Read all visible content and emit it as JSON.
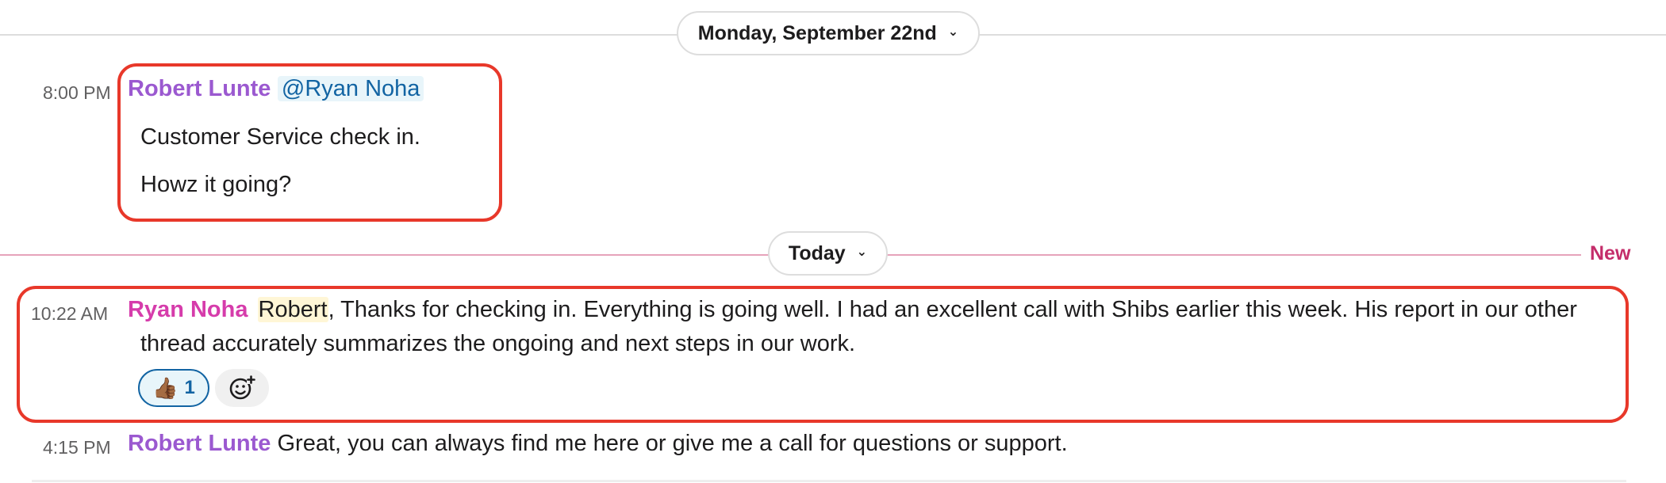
{
  "colors": {
    "author_robert": "#9b59d0",
    "author_ryan": "#d63cab",
    "new_label": "#c42d6a",
    "new_divider": "#e6a3ba",
    "highlight_box": "#e8382a",
    "timestamp": "#616061"
  },
  "dividers": {
    "date": {
      "label": "Monday, September 22nd",
      "icon": "chevron-down-icon"
    },
    "today": {
      "label": "Today",
      "icon": "chevron-down-icon"
    },
    "new_label": "New"
  },
  "messages": [
    {
      "time": "8:00 PM",
      "author": "Robert Lunte",
      "mention": "@Ryan Noha",
      "lines": [
        "Customer Service check in.",
        "Howz it going?"
      ]
    },
    {
      "time": "10:22 AM",
      "author": "Ryan Noha",
      "mention": "Robert",
      "text_line1": ", Thanks for checking in. Everything is going well. I had an excellent call with Shibs earlier this week. His report in our other",
      "text_line2": "thread accurately summarizes the ongoing and next steps in our work.",
      "reaction": {
        "emoji": "👍🏾",
        "icon": "thumbs-up-icon",
        "count": "1"
      },
      "add_reaction_icon": "add-reaction-icon"
    },
    {
      "time": "4:15 PM",
      "author": "Robert Lunte",
      "text": "Great, you can always find me here or give me a call for questions or support."
    }
  ]
}
